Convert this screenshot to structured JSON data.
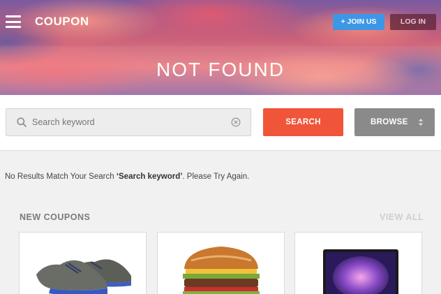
{
  "header": {
    "brand": "COUPON",
    "join_label": "+ JOIN US",
    "login_label": "LOG IN",
    "menu_icon": "hamburger-menu-icon"
  },
  "hero": {
    "title": "NOT FOUND"
  },
  "search": {
    "placeholder": "Search keyword",
    "value": "",
    "search_label": "SEARCH",
    "browse_label": "BROWSE"
  },
  "results": {
    "message_prefix": "No Results Match Your Search ",
    "query": "‘Search keyword’",
    "message_suffix": ". Please Try Again."
  },
  "new_coupons": {
    "title": "NEW COUPONS",
    "view_all_label": "VIEW ALL",
    "items": [
      {
        "image": "sneakers-image"
      },
      {
        "image": "burger-image"
      },
      {
        "image": "laptop-image"
      }
    ]
  },
  "colors": {
    "search_button": "#f0553a",
    "browse_button": "#8a8a8a",
    "join_button": "#3d97e6",
    "login_button": "#5f2337"
  }
}
